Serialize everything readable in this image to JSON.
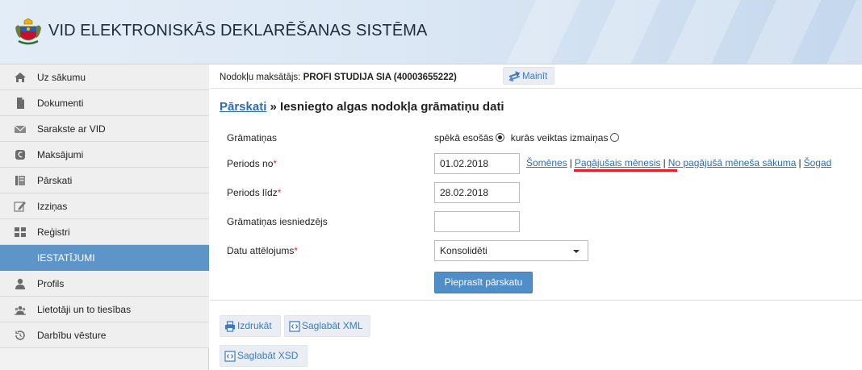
{
  "header": {
    "app_title": "VID ELEKTRONISKĀS DEKLARĒŠANAS SISTĒMA",
    "logo_icon": "coat-of-arms-icon"
  },
  "sidebar": {
    "items": [
      {
        "label": "Uz sākumu",
        "icon": "home-icon"
      },
      {
        "label": "Dokumenti",
        "icon": "document-icon"
      },
      {
        "label": "Sarakste ar VID",
        "icon": "envelope-icon"
      },
      {
        "label": "Maksājumi",
        "icon": "euro-icon"
      },
      {
        "label": "Pārskati",
        "icon": "report-icon"
      },
      {
        "label": "Izziņas",
        "icon": "edit-icon"
      },
      {
        "label": "Reģistri",
        "icon": "grid-icon"
      },
      {
        "label": "IESTATĪJUMI",
        "icon": "",
        "active": true
      },
      {
        "label": "Profils",
        "icon": "user-icon"
      },
      {
        "label": "Lietotāji un to tiesības",
        "icon": "users-icon"
      },
      {
        "label": "Darbību vēsture",
        "icon": "history-icon"
      }
    ]
  },
  "taxpayer": {
    "label": "Nodokļu maksātājs:",
    "name": "PROFI STUDIJA SIA (40003655222)",
    "change_label": "Mainīt"
  },
  "page": {
    "breadcrumb_link": "Pārskati",
    "title_rest": " » Iesniegto algas nodokļa grāmatiņu dati"
  },
  "form": {
    "books_label": "Grāmatiņas",
    "books_option_valid": "spēkā esošās",
    "books_option_changed": "kurās veiktas izmaiņas",
    "period_from_label": "Periods no",
    "period_from_value": "01.02.2018",
    "period_to_label": "Periods līdz",
    "period_to_value": "28.02.2018",
    "submitter_label": "Grāmatiņas iesniedzējs",
    "submitter_value": "",
    "display_label": "Datu attēlojums",
    "display_value": "Konsolidēti",
    "required_mark": "*",
    "submit_label": "Pieprasīt pārskatu",
    "shortcuts": [
      "Šomēnes",
      "Pagājušais mēnesis",
      "No pagājušā mēneša sākuma",
      "Šogad"
    ],
    "shortcut_separator": "|"
  },
  "tools": {
    "print_label": "Izdrukāt",
    "save_xml_label": "Saglabāt XML",
    "save_xsd_label": "Saglabāt XSD"
  },
  "colors": {
    "active_sidebar": "#5d95c9",
    "link": "#2d6db1",
    "primary_button": "#4f8ec8",
    "required": "#d0312d",
    "highlight_underline": "#e0202a"
  }
}
